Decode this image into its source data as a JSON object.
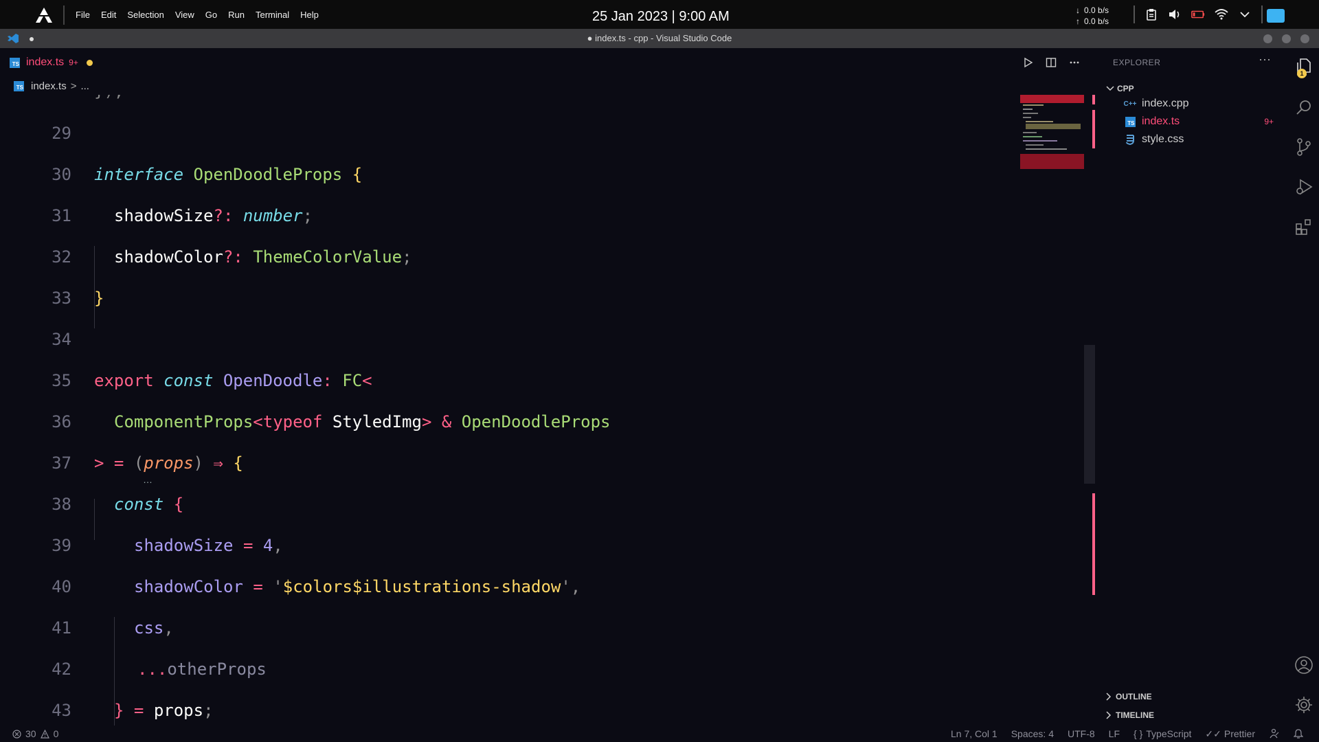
{
  "system": {
    "menu": [
      "File",
      "Edit",
      "Selection",
      "View",
      "Go",
      "Run",
      "Terminal",
      "Help"
    ],
    "clock": "25 Jan 2023 | 9:00 AM",
    "net_down": "0.0 b/s",
    "net_up": "0.0 b/s",
    "down_arrow": "↓",
    "up_arrow": "↑"
  },
  "window": {
    "title": "● index.ts - cpp - Visual Studio Code"
  },
  "tab": {
    "label": "index.ts",
    "problems": "9+"
  },
  "breadcrumb": {
    "file": "index.ts",
    "sep": ">",
    "rest": "..."
  },
  "editor": {
    "partial_line": "});",
    "line_numbers": [
      "29",
      "30",
      "31",
      "32",
      "33",
      "34",
      "35",
      "36",
      "37",
      "38",
      "39",
      "40",
      "41",
      "42",
      "43"
    ]
  },
  "explorer": {
    "title": "EXPLORER",
    "more": "···",
    "folder": "CPP",
    "files": [
      {
        "name": "index.cpp",
        "icon": "cpp-file-icon",
        "color": "#cfcfcf"
      },
      {
        "name": "index.ts",
        "icon": "ts-file-icon",
        "color": "#ff4d79",
        "count": "9+"
      },
      {
        "name": "style.css",
        "icon": "css-file-icon",
        "color": "#cfcfcf"
      }
    ],
    "outline": "OUTLINE",
    "timeline": "TIMELINE"
  },
  "activity": {
    "explorer_badge": "1"
  },
  "status": {
    "errors": "30",
    "warnings": "0",
    "position": "Ln 7, Col 1",
    "spaces": "Spaces: 4",
    "encoding": "UTF-8",
    "eol": "LF",
    "language": "TypeScript",
    "formatter": "Prettier"
  },
  "colors": {
    "accent_pink": "#ff4d79",
    "badge_yellow": "#f2c94c",
    "ts_blue": "#2b8bd6"
  }
}
